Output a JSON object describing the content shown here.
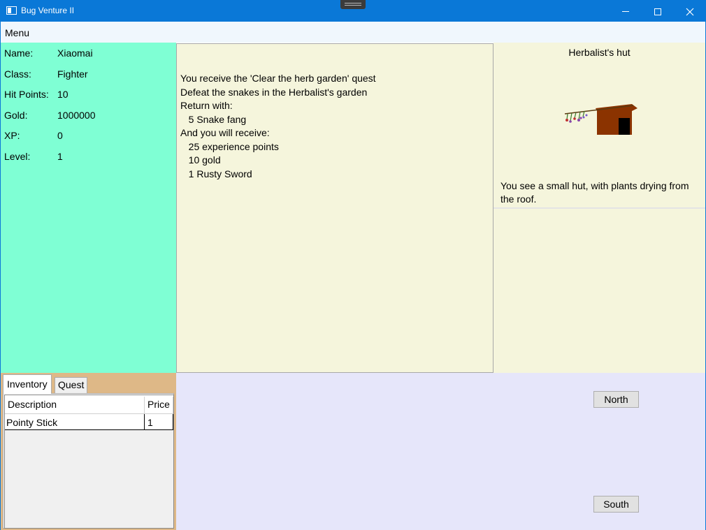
{
  "window": {
    "title": "Bug Venture II"
  },
  "menu": {
    "label": "Menu"
  },
  "player": {
    "stats": [
      {
        "label": "Name:",
        "value": "Xiaomai"
      },
      {
        "label": "Class:",
        "value": "Fighter"
      },
      {
        "label": "Hit Points:",
        "value": "10"
      },
      {
        "label": "Gold:",
        "value": "1000000"
      },
      {
        "label": "XP:",
        "value": "0"
      },
      {
        "label": "Level:",
        "value": "1"
      }
    ]
  },
  "messages": [
    "You receive the 'Clear the herb garden' quest",
    "Defeat the snakes in the Herbalist's garden",
    "Return with:",
    "   5 Snake fang",
    "And you will receive:",
    "   25 experience points",
    "   10 gold",
    "   1 Rusty Sword"
  ],
  "location": {
    "name": "Herbalist's hut",
    "description": "You see a small hut, with plants drying from the roof."
  },
  "tabs": {
    "inventory": "Inventory",
    "quest": "Quest"
  },
  "inventory": {
    "columns": {
      "description": "Description",
      "price": "Price"
    },
    "rows": [
      {
        "description": "Pointy Stick",
        "price": "1"
      }
    ]
  },
  "navigation": {
    "north": "North",
    "south": "South"
  },
  "colors": {
    "titlebar": "#0a78d7",
    "stats_bg": "#7fffd4",
    "panel_bg": "#f5f5dc",
    "tabs_bg": "#deb887",
    "nav_bg": "#e6e6fa",
    "hut_wall": "#8b3300"
  }
}
